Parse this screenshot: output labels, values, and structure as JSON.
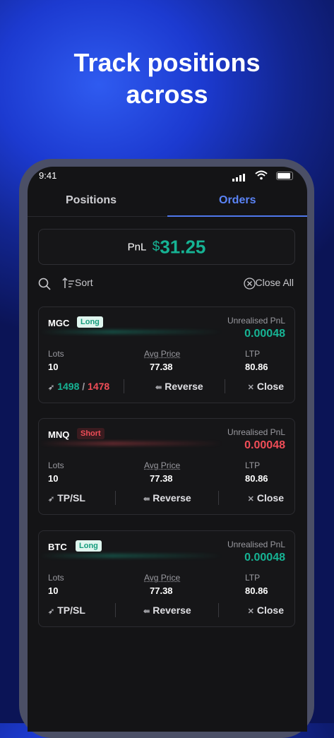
{
  "headline": {
    "line1": "Track positions",
    "line2": "across"
  },
  "status": {
    "time": "9:41"
  },
  "tabs": [
    {
      "label": "Positions"
    },
    {
      "label": "Orders"
    }
  ],
  "pnl": {
    "label": "PnL",
    "currency": "$",
    "value": "31.25"
  },
  "toolbar": {
    "sort_label": "Sort",
    "close_all_label": "Close All"
  },
  "labels": {
    "unrealised": "Unrealised PnL",
    "lots": "Lots",
    "avg_price": "Avg Price",
    "ltp": "LTP",
    "tpsl": "TP/SL",
    "reverse": "Reverse",
    "close": "Close"
  },
  "positions": [
    {
      "symbol": "MGC",
      "side": "Long",
      "unrealised": "0.00048",
      "lots": "10",
      "avg_price": "77.38",
      "ltp": "80.86",
      "tp": "1498",
      "slash": "/",
      "sl": "1478"
    },
    {
      "symbol": "MNQ",
      "side": "Short",
      "unrealised": "0.00048",
      "lots": "10",
      "avg_price": "77.38",
      "ltp": "80.86"
    },
    {
      "symbol": "BTC",
      "side": "Long",
      "unrealised": "0.00048",
      "lots": "10",
      "avg_price": "77.38",
      "ltp": "80.86"
    }
  ],
  "colors": {
    "profit": "#16b394",
    "loss": "#ef4d57",
    "accent": "#5b84f7"
  }
}
